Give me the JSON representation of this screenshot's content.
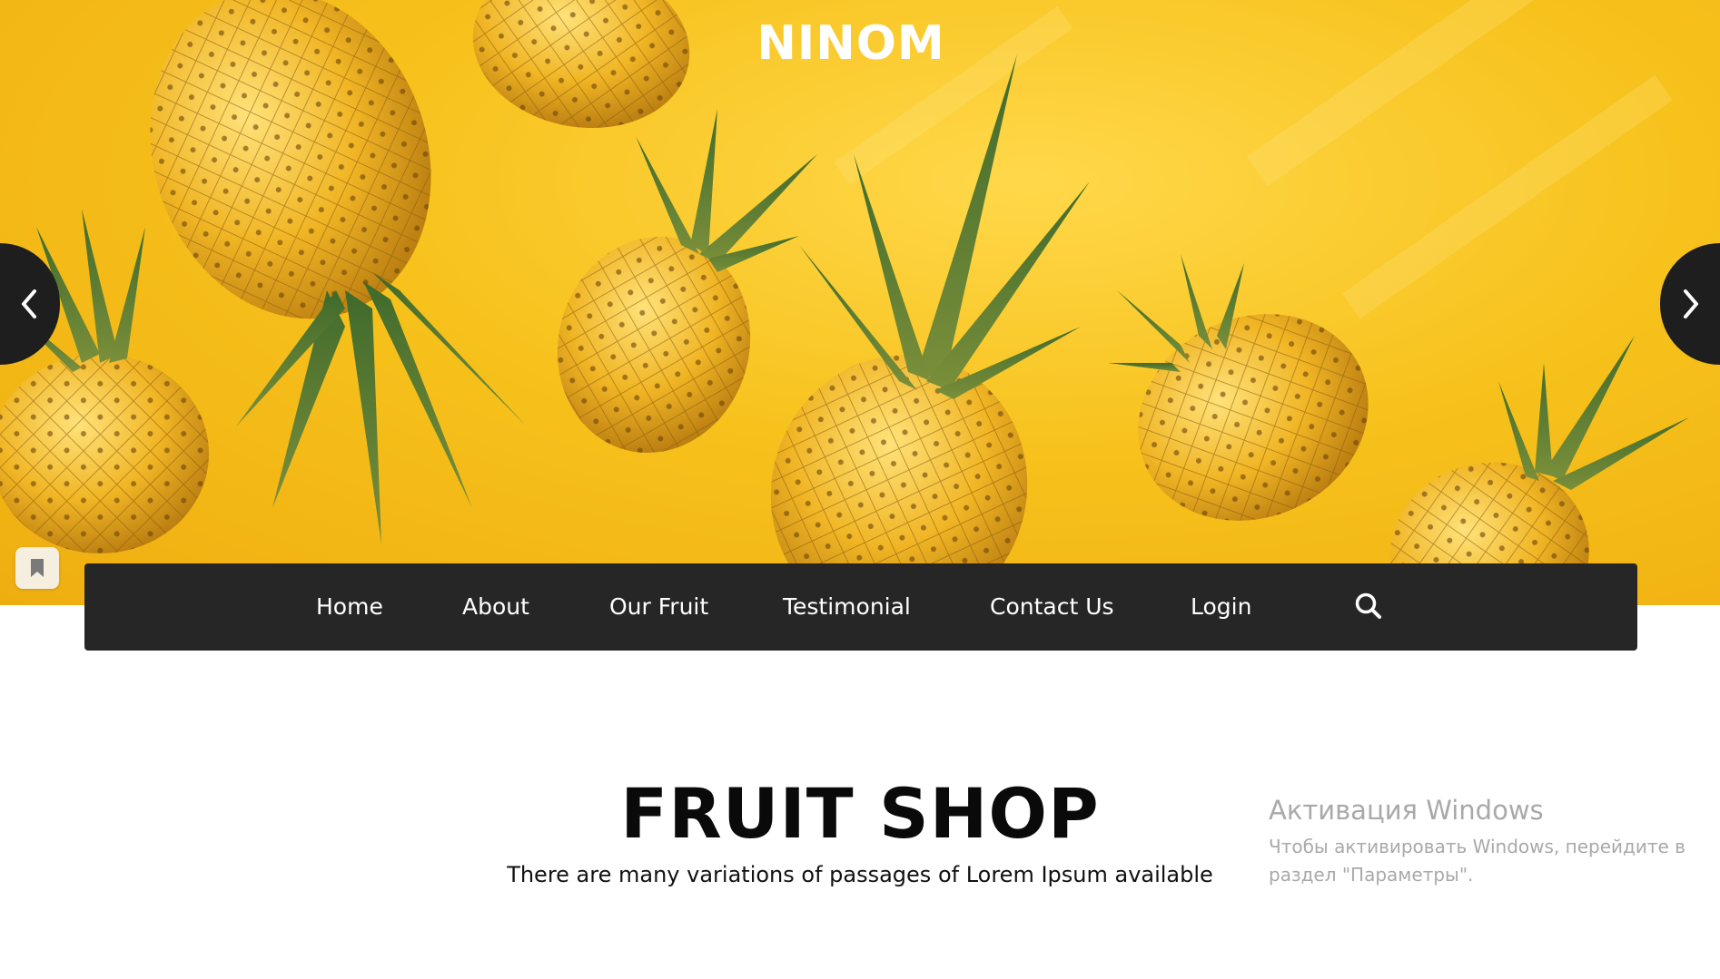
{
  "brand": {
    "name": "NINOM"
  },
  "slider": {
    "prev_icon": "chevron-left-icon",
    "next_icon": "chevron-right-icon"
  },
  "nav": {
    "items": [
      "Home",
      "About",
      "Our Fruit",
      "Testimonial",
      "Contact Us",
      "Login"
    ],
    "search_icon": "search-icon"
  },
  "main": {
    "title": "FRUIT SHOP",
    "subtitle": "There are many variations of passages of Lorem Ipsum available"
  },
  "windows_watermark": {
    "title": "Активация Windows",
    "line": "Чтобы активировать Windows, перейдите в раздел \"Параметры\"."
  },
  "colors": {
    "hero_yellow": "#f7c21c",
    "navbar_bg": "#262626",
    "text_dark": "#0a0a0a",
    "white": "#ffffff"
  }
}
